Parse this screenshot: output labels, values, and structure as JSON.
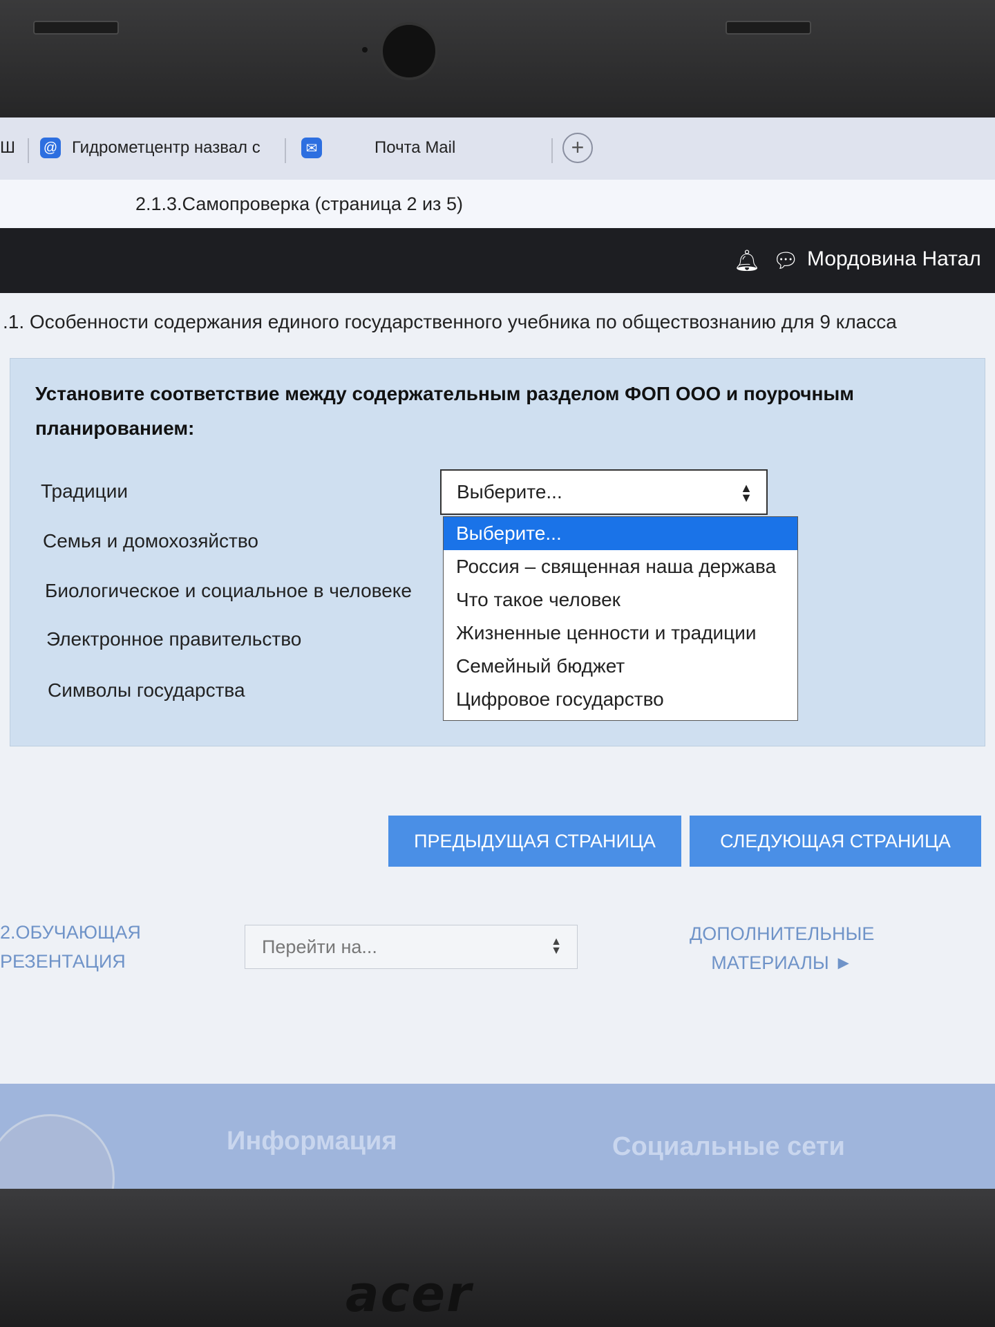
{
  "browser": {
    "tabs": [
      {
        "label": "Ш"
      },
      {
        "label": "Гидрометцентр назвал с",
        "icon": "at-sign-icon"
      },
      {
        "label": "Почта Mail",
        "icon": "mail-icon"
      }
    ],
    "new_tab_symbol": "+",
    "page_title": "2.1.3.Самопроверка (страница 2 из 5)"
  },
  "header": {
    "user_name": "Мордовина Натал"
  },
  "breadcrumb": ".1. Особенности содержания единого государственного учебника по обществознанию для 9 класса",
  "question": {
    "text": "Установите соответствие между содержательным разделом ФОП ООО и поурочным планированием:",
    "items": [
      "Традиции",
      "Семья и домохозяйство",
      "Биологическое и социальное в человеке",
      "Электронное правительство",
      "Символы государства"
    ],
    "select_value": "Выберите...",
    "options": [
      "Выберите...",
      "Россия – священная наша держава",
      "Что такое человек",
      "Жизненные ценности и традиции",
      "Семейный бюджет",
      "Цифровое государство"
    ],
    "highlighted_option_index": 0
  },
  "navigation": {
    "prev_button": "ПРЕДЫДУЩАЯ СТРАНИЦА",
    "next_button": "СЛЕДУЮЩАЯ СТРАНИЦА",
    "prev_link_line1": "2.ОБУЧАЮЩАЯ",
    "prev_link_line2": "РЕЗЕНТАЦИЯ",
    "jump_placeholder": "Перейти на...",
    "next_link_line1": "ДОПОЛНИТЕЛЬНЫЕ",
    "next_link_line2": "МАТЕРИАЛЫ ►"
  },
  "footer": {
    "info_heading": "Информация",
    "social_heading": "Социальные сети"
  },
  "device": {
    "brand": "acer"
  },
  "colors": {
    "accent": "#1a73e8",
    "button": "#4a8fe6",
    "question_bg": "#cfdff0",
    "topnav": "#1d1e22"
  }
}
